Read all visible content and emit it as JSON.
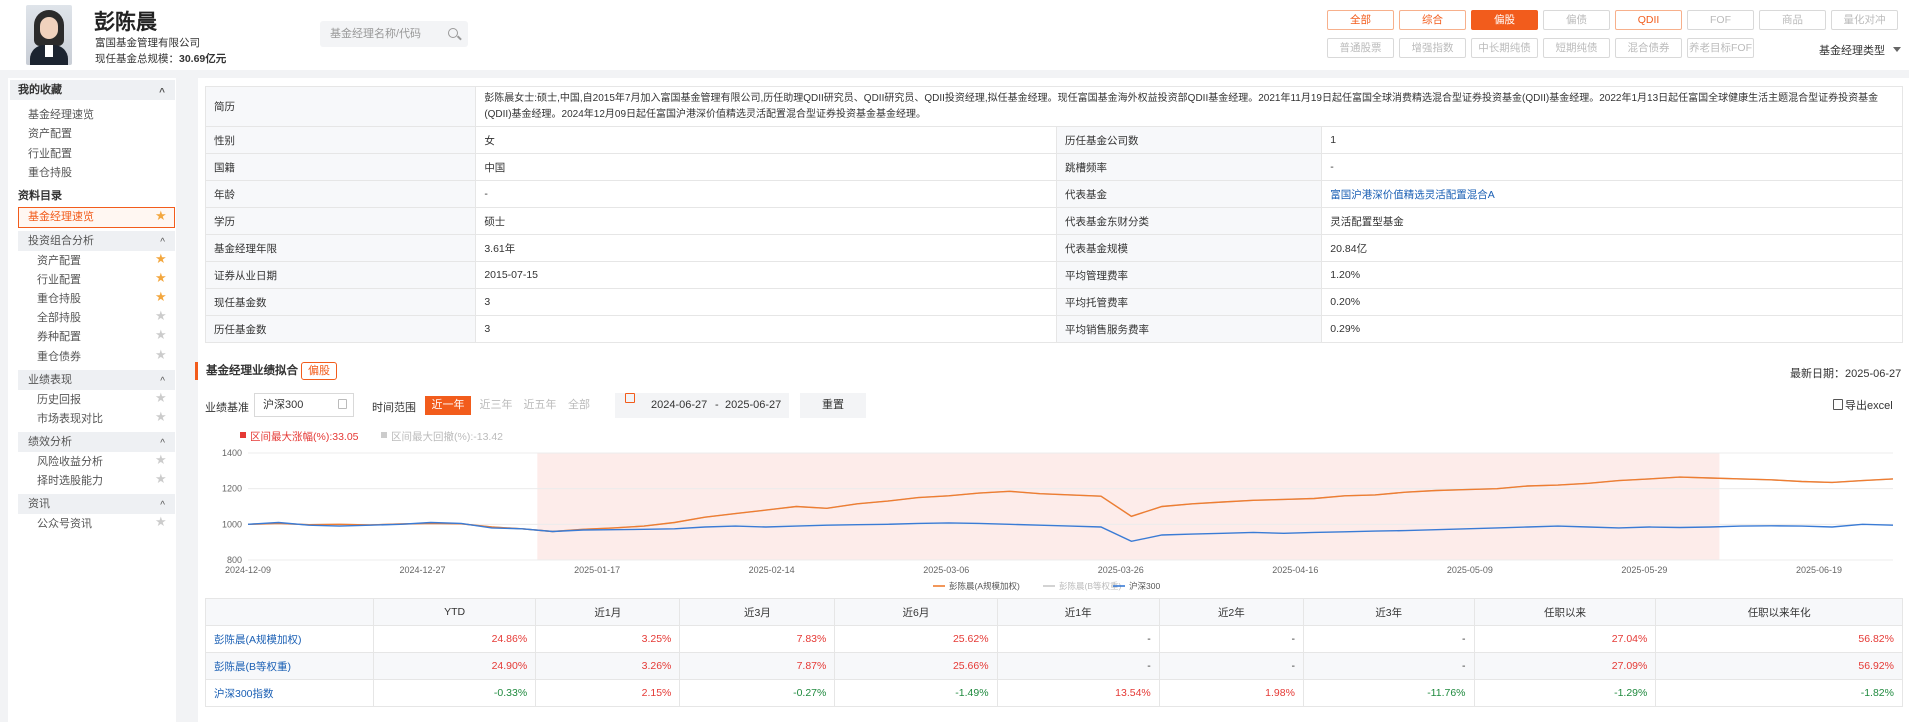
{
  "manager": {
    "name": "彭陈晨",
    "company": "富国基金管理有限公司",
    "aum_label": "现任基金总规模：",
    "aum_value": "30.69亿元"
  },
  "search": {
    "placeholder": "基金经理名称/代码"
  },
  "filters": {
    "row1": [
      {
        "label": "全部",
        "state": "selected"
      },
      {
        "label": "综合",
        "state": "selected"
      },
      {
        "label": "偏股",
        "state": "active"
      },
      {
        "label": "偏债",
        "state": "disabled"
      },
      {
        "label": "QDII",
        "state": "selected"
      },
      {
        "label": "FOF",
        "state": "disabled"
      },
      {
        "label": "商品",
        "state": "disabled"
      },
      {
        "label": "量化对冲",
        "state": "disabled"
      }
    ],
    "row2": [
      {
        "label": "普通股票"
      },
      {
        "label": "增强指数"
      },
      {
        "label": "中长期纯债"
      },
      {
        "label": "短期纯债"
      },
      {
        "label": "混合债券"
      },
      {
        "label": "养老目标FOF"
      }
    ],
    "type_label": "基金经理类型"
  },
  "sidebar": {
    "favorites_title": "我的收藏",
    "favorites": [
      "基金经理速览",
      "资产配置",
      "行业配置",
      "重仓持股"
    ],
    "catalog_title": "资料目录",
    "overview": "基金经理速览",
    "portfolio_title": "投资组合分析",
    "portfolio_items": [
      "资产配置",
      "行业配置",
      "重仓持股",
      "全部持股",
      "券种配置",
      "重仓债券"
    ],
    "performance_title": "业绩表现",
    "performance_items": [
      "历史回报",
      "市场表现对比"
    ],
    "efficiency_title": "绩效分析",
    "efficiency_items": [
      "风险收益分析",
      "择时选股能力"
    ],
    "news_title": "资讯",
    "news_items": [
      "公众号资讯"
    ]
  },
  "info": {
    "bio_label": "简历",
    "bio": "彭陈晨女士:硕士,中国,自2015年7月加入富国基金管理有限公司,历任助理QDII研究员、QDII研究员、QDII投资经理,拟任基金经理。现任富国基金海外权益投资部QDII基金经理。2021年11月19日起任富国全球消费精选混合型证券投资基金(QDII)基金经理。2022年1月13日起任富国全球健康生活主题混合型证券投资基金(QDII)基金经理。2024年12月09日起任富国沪港深价值精选灵活配置混合型证券投资基金基金经理。",
    "rows": [
      {
        "l1": "性别",
        "v1": "女",
        "l2": "历任基金公司数",
        "v2": "1"
      },
      {
        "l1": "国籍",
        "v1": "中国",
        "l2": "跳槽频率",
        "v2": "-"
      },
      {
        "l1": "年龄",
        "v1": "-",
        "l2": "代表基金",
        "v2": "富国沪港深价值精选灵活配置混合A",
        "link": true
      },
      {
        "l1": "学历",
        "v1": "硕士",
        "l2": "代表基金东财分类",
        "v2": "灵活配置型基金"
      },
      {
        "l1": "基金经理年限",
        "v1": "3.61年",
        "l2": "代表基金规模",
        "v2": "20.84亿"
      },
      {
        "l1": "证券从业日期",
        "v1": "2015-07-15",
        "l2": "平均管理费率",
        "v2": "1.20%"
      },
      {
        "l1": "现任基金数",
        "v1": "3",
        "l2": "平均托管费率",
        "v2": "0.20%"
      },
      {
        "l1": "历任基金数",
        "v1": "3",
        "l2": "平均销售服务费率",
        "v2": "0.29%"
      }
    ]
  },
  "performance": {
    "title": "基金经理业绩拟合",
    "tag": "偏股",
    "update_label": "最新日期：2025-06-27",
    "bench_label": "业绩基准",
    "bench_value": "沪深300",
    "range_label": "时间范围",
    "ranges": [
      "近一年",
      "近三年",
      "近五年",
      "全部"
    ],
    "date_start": "2024-06-27",
    "date_sep": "-",
    "date_end": "2025-06-27",
    "reset": "重置",
    "export": "导出excel",
    "max_gain": "区间最大涨幅(%):33.05",
    "max_dd": "区间最大回撤(%):-13.42",
    "colors": {
      "manager_a": "#ef7d31",
      "manager_b": "#c8c8c8",
      "hs300": "#3a7bd5",
      "shade": "#fdecea"
    }
  },
  "chart_data": {
    "type": "line",
    "x_ticks": [
      "2024-12-09",
      "2024-12-27",
      "2025-01-17",
      "2025-02-14",
      "2025-03-06",
      "2025-03-26",
      "2025-04-16",
      "2025-05-09",
      "2025-05-29",
      "2025-06-19"
    ],
    "ylim": [
      800,
      1400
    ],
    "y_ticks": [
      800,
      1000,
      1200,
      1400
    ],
    "grid": true,
    "legend_position": "bottom",
    "highlight_range": [
      "2025-01-13",
      "2025-06-05"
    ],
    "series": [
      {
        "name": "彭陈晨(A规模加权)",
        "values": [
          1000,
          1005,
          998,
          1000,
          997,
          1002,
          1005,
          1003,
          985,
          975,
          960,
          972,
          980,
          990,
          1010,
          1040,
          1060,
          1080,
          1100,
          1090,
          1115,
          1130,
          1150,
          1160,
          1175,
          1185,
          1172,
          1165,
          1158,
          1045,
          1100,
          1115,
          1125,
          1135,
          1140,
          1145,
          1160,
          1165,
          1180,
          1190,
          1195,
          1200,
          1215,
          1220,
          1230,
          1245,
          1255,
          1265,
          1260,
          1255,
          1250,
          1240,
          1235,
          1245,
          1255
        ]
      },
      {
        "name": "彭陈晨(B等权重)",
        "values": [
          1000,
          1005,
          998,
          1000,
          997,
          1002,
          1005,
          1003,
          985,
          975,
          960,
          972,
          980,
          990,
          1010,
          1040,
          1060,
          1080,
          1100,
          1090,
          1115,
          1130,
          1150,
          1160,
          1175,
          1185,
          1172,
          1165,
          1158,
          1045,
          1100,
          1115,
          1125,
          1135,
          1140,
          1145,
          1160,
          1165,
          1180,
          1190,
          1195,
          1200,
          1215,
          1220,
          1230,
          1245,
          1255,
          1265,
          1260,
          1255,
          1250,
          1240,
          1235,
          1245,
          1255
        ]
      },
      {
        "name": "沪深300",
        "values": [
          1000,
          1010,
          995,
          990,
          995,
          1000,
          1010,
          1005,
          980,
          975,
          960,
          968,
          970,
          972,
          975,
          985,
          990,
          985,
          990,
          995,
          998,
          1000,
          1005,
          1008,
          1005,
          1000,
          995,
          990,
          985,
          905,
          940,
          945,
          950,
          955,
          950,
          955,
          958,
          962,
          965,
          970,
          975,
          980,
          985,
          990,
          985,
          980,
          985,
          982,
          985,
          990,
          992,
          990,
          985,
          1000,
          995
        ]
      }
    ]
  },
  "perf_table": {
    "headers": [
      "",
      "YTD",
      "近1月",
      "近3月",
      "近6月",
      "近1年",
      "近2年",
      "近3年",
      "任职以来",
      "任职以来年化"
    ],
    "rows": [
      {
        "name": "彭陈晨(A规模加权)",
        "vals": [
          "24.86%",
          "3.25%",
          "7.83%",
          "25.62%",
          "-",
          "-",
          "-",
          "27.04%",
          "56.82%"
        ],
        "cls": [
          "red",
          "red",
          "red",
          "red",
          "dash",
          "dash",
          "dash",
          "red",
          "red"
        ]
      },
      {
        "name": "彭陈晨(B等权重)",
        "vals": [
          "24.90%",
          "3.26%",
          "7.87%",
          "25.66%",
          "-",
          "-",
          "-",
          "27.09%",
          "56.92%"
        ],
        "cls": [
          "red",
          "red",
          "red",
          "red",
          "dash",
          "dash",
          "dash",
          "red",
          "red"
        ]
      },
      {
        "name": "沪深300指数",
        "vals": [
          "-0.33%",
          "2.15%",
          "-0.27%",
          "-1.49%",
          "13.54%",
          "1.98%",
          "-11.76%",
          "-1.29%",
          "-1.82%"
        ],
        "cls": [
          "green",
          "red",
          "green",
          "green",
          "red",
          "red",
          "green",
          "green",
          "green"
        ]
      }
    ]
  }
}
